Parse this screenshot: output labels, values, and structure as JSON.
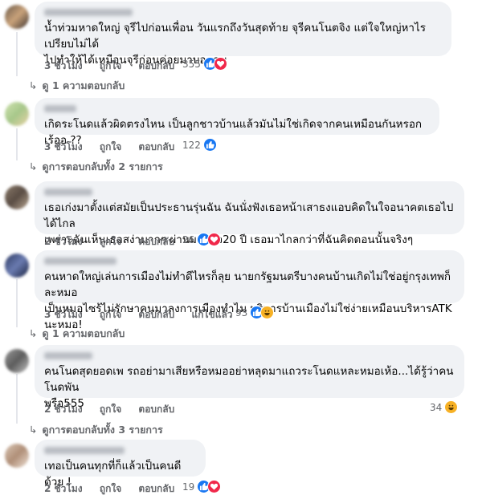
{
  "comments": [
    {
      "text": "น้ำท่วมหาดใหญ่ จุรีไปก่อนเพื่อน วันแรกถึงวันสุดท้าย จุรีคนโนตจิง แต่ใจใหญ่หาไรเปรียบไม่ได้\nไปทำให้ได้เหมือนจุรีก่อนค่อยมาบอกคน",
      "time": "3 ชั่วโมง",
      "like": "ถูกใจ",
      "reply": "ตอบกลับ",
      "count": "355",
      "replies": "ดู 1 ความตอบกลับ"
    },
    {
      "text": "เกิดระโนดแล้วผิดตรงไหน เป็นลูกชาวบ้านแล้วมันไม่ใช่เกิดจากคนเหมือนกันหรอกเร้ออ ??",
      "time": "3 ชั่วโมง",
      "like": "ถูกใจ",
      "reply": "ตอบกลับ",
      "count": "122",
      "replies": "ดูการตอบกลับทั้ง 2 รายการ"
    },
    {
      "text": "เธอเก่งมาตั้งแต่สมัยเป็นประธานรุ่นฉัน ฉันนั่งฟังเธอหน้าเสาธงแอบคิดในใจอนาคตเธอไปได้ไกล\nเพราะฉันเห็นเธอสง่ามากๆ ผ่านมาแล้ว20 ปี เธอมาไกลกว่าที่ฉันคิดตอนนั้นจริงๆ",
      "time": "2 ชั่วโมง",
      "like": "ถูกใจ",
      "reply": "ตอบกลับ",
      "count": "26"
    },
    {
      "text": "คนหาดใหญ่เล่นการเมืองไม่ทำดีไหรก็ลุย นายกรัฐมนตรีบางคนบ้านเกิดไม่ใช่อยู่กรุงเทพก็ละหมอ\nเป็นหมอไซร้ไม่รักษาคนมาลงการเมืองทำไม บริหารบ้านเมืองไม่ใช่ง่ายเหมือนบริหารATK นะหมอ!",
      "time": "3 ชั่วโมง",
      "like": "ถูกใจ",
      "reply": "ตอบกลับ",
      "edited": "แก้ไขแล้ว",
      "count": "93",
      "replies": "ดู 1 ความตอบกลับ"
    },
    {
      "text": "คนโนดสุดยอดเพ รถอย่ามาเสียหรือหมออย่าหลุดมาแถวระโนดแหละหมอเห้อ...ได้รู้ว่าคนโนดพัน\nพรือ555",
      "time": "2 ชั่วโมง",
      "like": "ถูกใจ",
      "reply": "ตอบกลับ",
      "count": "34",
      "replies": "ดูการตอบกลับทั้ง 3 รายการ"
    },
    {
      "text": "เทอเป็นคนทุกที่ก็แล้วเป็นคนดีด้วย !",
      "time": "2 ชั่วโมง",
      "like": "ถูกใจ",
      "reply": "ตอบกลับ",
      "count": "19"
    }
  ],
  "colors": {
    "like": "#1877f2",
    "love": "#f0284a",
    "haha": "#f7b125"
  }
}
